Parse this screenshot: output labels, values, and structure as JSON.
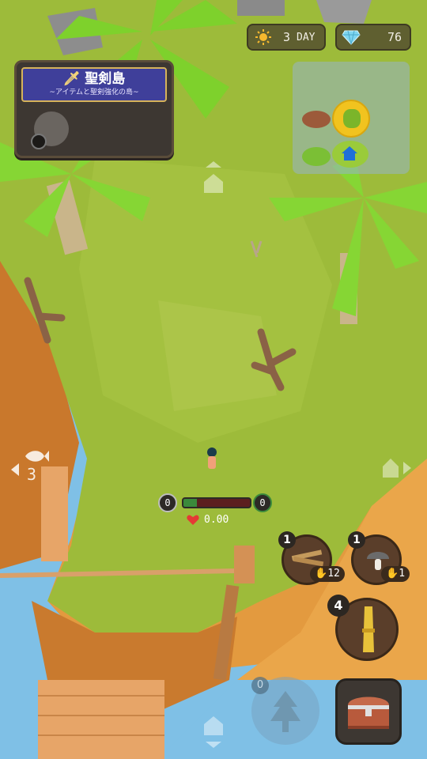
{
  "hud": {
    "day_value": "3",
    "day_unit": "DAY",
    "gems": "76"
  },
  "island_card": {
    "name": "聖剣島",
    "subtitle": "~アイテムと聖剣強化の島~"
  },
  "left_nav": {
    "count": "3"
  },
  "player": {
    "level_left": "0",
    "level_right": "0",
    "hp_fraction": 0.2,
    "stat": "0.00"
  },
  "inventory": {
    "slots": [
      {
        "badge": "1",
        "count": "12",
        "icon": "wood-planks-icon"
      },
      {
        "badge": "1",
        "count": "1",
        "icon": "mushroom-icon"
      },
      {
        "badge": "4",
        "icon": "wheat-bundle-icon"
      }
    ]
  },
  "action": {
    "dim_badge": "0"
  },
  "colors": {
    "grass": "#9dbb3a",
    "sand": "#e9a447",
    "water": "#7fc0e6",
    "banner": "#3f3f9a"
  }
}
